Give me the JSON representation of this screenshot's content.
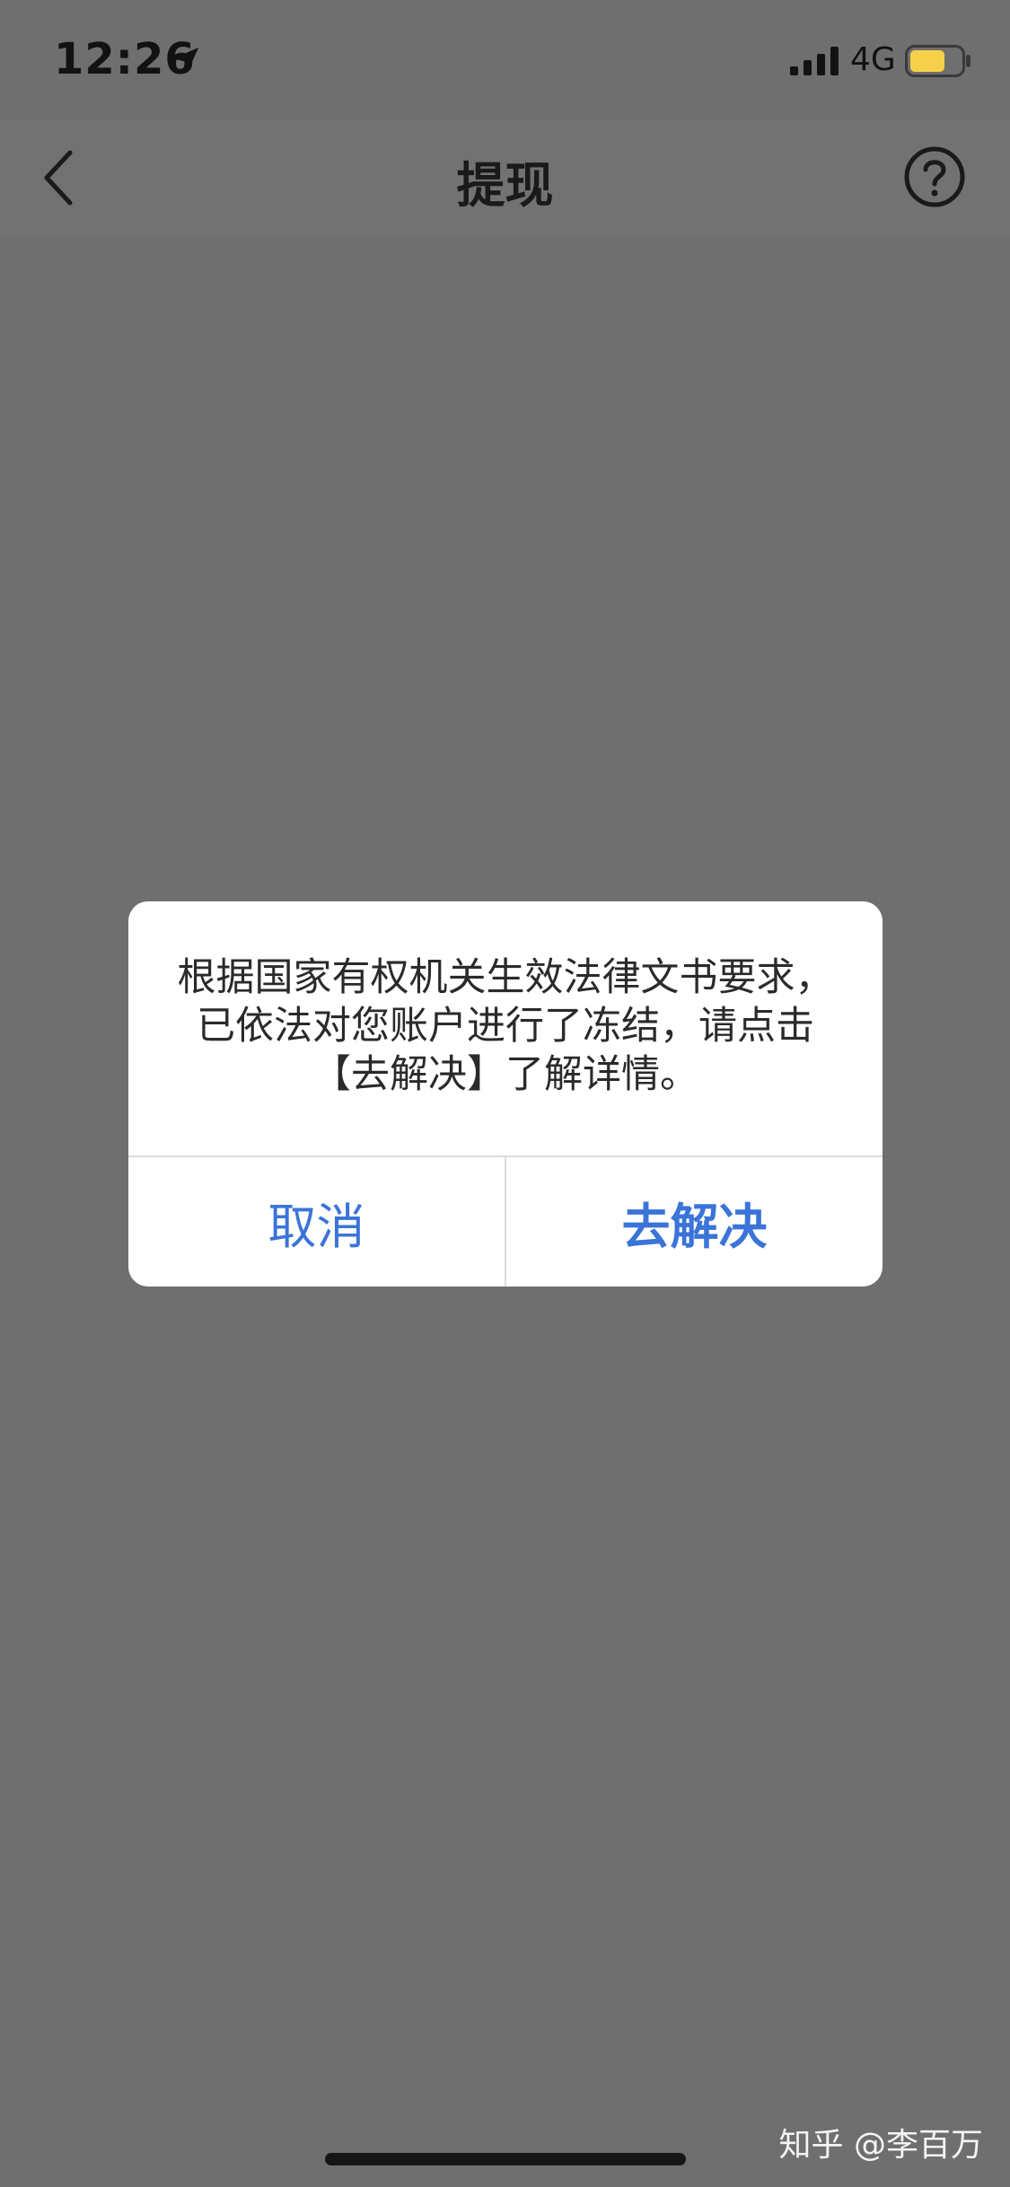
{
  "status_bar": {
    "time": "12:26",
    "network": "4G",
    "battery_color": "#f7d04a"
  },
  "nav": {
    "title": "提现",
    "back_icon": "chevron-left-icon",
    "help_icon": "question-circle-icon"
  },
  "dialog": {
    "message": "根据国家有权机关生效法律文书要求，已依法对您账户进行了冻结，请点击【去解决】了解详情。",
    "cancel_label": "取消",
    "confirm_label": "去解决",
    "button_color": "#3b74d8"
  },
  "watermark": {
    "text": "知乎 @李百万"
  }
}
